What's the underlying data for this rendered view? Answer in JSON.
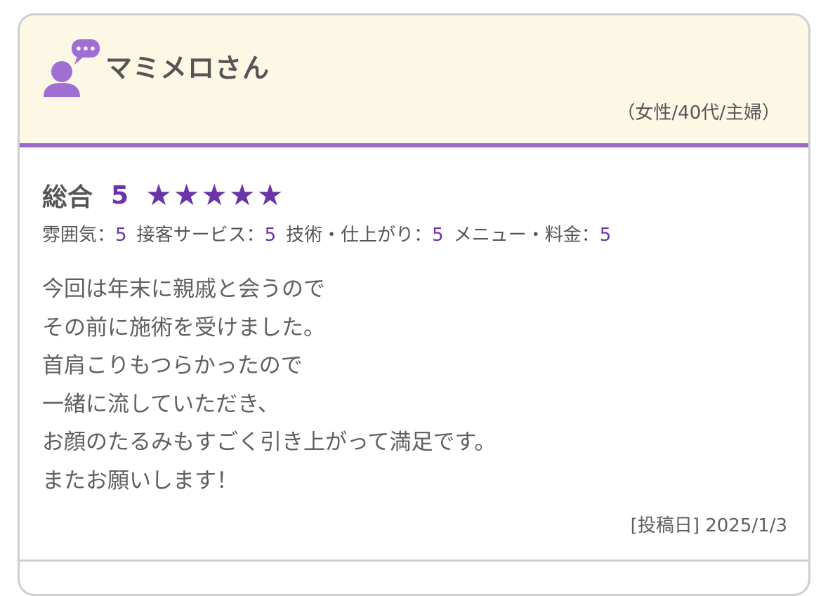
{
  "reviewer": {
    "name": "マミメロさん",
    "meta": "（女性/40代/主婦）"
  },
  "rating": {
    "overall_label": "総合",
    "overall_score": "5",
    "stars": 5,
    "star_glyph": "★",
    "categories": [
      {
        "label": "雰囲気：",
        "value": "5"
      },
      {
        "label": "接客サービス：",
        "value": "5"
      },
      {
        "label": "技術・仕上がり：",
        "value": "5"
      },
      {
        "label": "メニュー・料金：",
        "value": "5"
      }
    ]
  },
  "comment": {
    "lines": [
      "今回は年末に親戚と会うので",
      "その前に施術を受けました。",
      "首肩こりもつらかったので",
      "一緒に流していただき、",
      "お顔のたるみもすごく引き上がって満足です。",
      "またお願いします！"
    ]
  },
  "post_date": "[投稿日] 2025/1/3",
  "colors": {
    "accent": "#6a35a8",
    "header_bg": "#fdf7e6",
    "header_border": "#9a6ac7",
    "avatar": "#a06fd3",
    "text": "#555555"
  },
  "icons": {
    "avatar": "user-speech-bubble-icon"
  }
}
